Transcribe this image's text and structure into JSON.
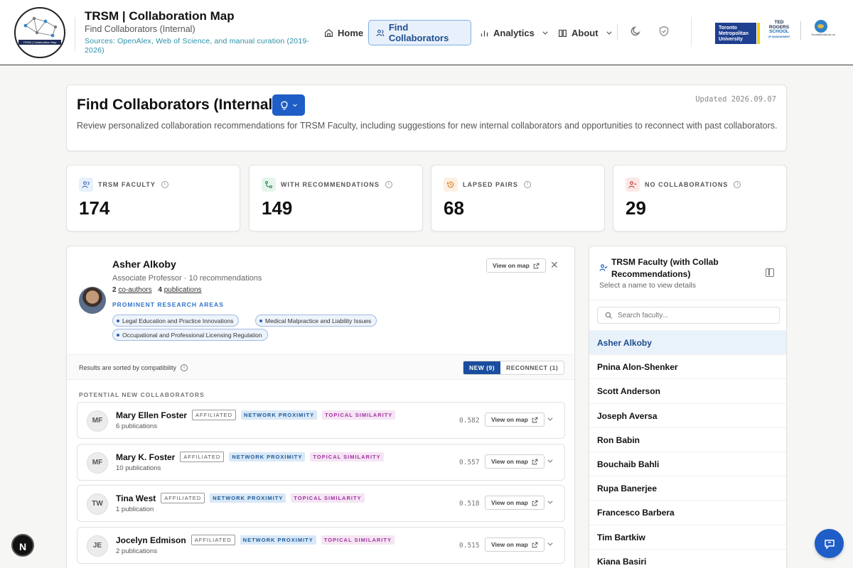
{
  "header": {
    "title": "TRSM | Collaboration Map",
    "subtitle": "Find Collaborators (Internal)",
    "sources": "Sources: OpenAlex, Web of Science, and manual curation (2019-2026)",
    "logo_text": "TRSM | Collaboration Map",
    "nav": {
      "home": "Home",
      "find": "Find Collaborators",
      "analytics": "Analytics",
      "about": "About"
    },
    "partners": {
      "tmu": [
        "Toronto",
        "Metropolitan",
        "University"
      ],
      "ted": [
        "TED",
        "ROGERS",
        "SCHOOL",
        "OF MANAGEMENT"
      ],
      "sml": "SocialMediaLab.ca"
    }
  },
  "intro": {
    "title": "Find Collaborators (Internal)",
    "updated": "Updated 2026.09.07",
    "description": "Review personalized collaboration recommendations for TRSM Faculty, including suggestions for new internal collaborators and opportunities to reconnect with past collaborators."
  },
  "stats": [
    {
      "label": "TRSM FACULTY",
      "value": "174",
      "icon": "users-icon",
      "color": "#3b6fb6",
      "bg": "#e8f0fb"
    },
    {
      "label": "WITH RECOMMENDATIONS",
      "value": "149",
      "icon": "route-icon",
      "color": "#2e8b57",
      "bg": "#e6f5ec"
    },
    {
      "label": "LAPSED PAIRS",
      "value": "68",
      "icon": "history-icon",
      "color": "#d9822b",
      "bg": "#fdf0e2"
    },
    {
      "label": "NO COLLABORATIONS",
      "value": "29",
      "icon": "user-minus-icon",
      "color": "#c0392b",
      "bg": "#fbe8e6"
    }
  ],
  "profile": {
    "name": "Asher Alkoby",
    "role": "Associate Professor · 10 recommendations",
    "coauthors_count": "2",
    "coauthors_label": "co-authors",
    "pubs_count": "4",
    "pubs_label": "publications",
    "view_map": "View on map",
    "areas_heading": "PROMINENT RESEARCH AREAS",
    "areas": [
      "Legal Education and Practice Innovations",
      "Medical Malpractice and Liability Issues",
      "Occupational and Professional Licensing Regulation"
    ]
  },
  "sorting": {
    "note": "Results are sorted by compatibility",
    "new_tab": "NEW (9)",
    "reconnect_tab": "RECONNECT (1)"
  },
  "potential_heading": "POTENTIAL NEW COLLABORATORS",
  "badges": {
    "affiliated": "AFFILIATED",
    "network": "NETWORK PROXIMITY",
    "topical": "TOPICAL SIMILARITY"
  },
  "recommendations": [
    {
      "initials": "MF",
      "name": "Mary Ellen Foster",
      "pubs": "6 publications",
      "score": "0.582"
    },
    {
      "initials": "MF",
      "name": "Mary K. Foster",
      "pubs": "10 publications",
      "score": "0.557"
    },
    {
      "initials": "TW",
      "name": "Tina West",
      "pubs": "1 publication",
      "score": "0.518"
    },
    {
      "initials": "JE",
      "name": "Jocelyn Edmison",
      "pubs": "2 publications",
      "score": "0.515"
    }
  ],
  "faculty_panel": {
    "title": "TRSM Faculty (with Collab Recommendations)",
    "subtitle": "Select a name to view details",
    "search_placeholder": "Search faculty...",
    "names": [
      "Asher Alkoby",
      "Pnina Alon-Shenker",
      "Scott Anderson",
      "Joseph Aversa",
      "Ron Babin",
      "Bouchaib Bahli",
      "Rupa Banerjee",
      "Francesco Barbera",
      "Tim Bartkiw",
      "Kiana Basiri"
    ]
  },
  "fab": {
    "n": "N"
  }
}
